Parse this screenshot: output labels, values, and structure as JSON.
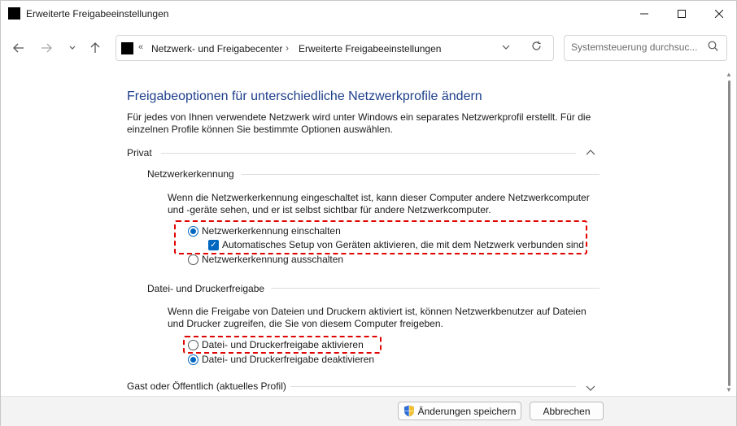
{
  "window": {
    "title": "Erweiterte Freigabeeinstellungen",
    "icons": [
      "app-icon",
      "minimize-icon",
      "maximize-icon",
      "close-icon"
    ]
  },
  "nav": {
    "icons": [
      "back-arrow-icon",
      "forward-arrow-icon",
      "recent-locations-chevron-icon",
      "up-arrow-icon"
    ]
  },
  "address": {
    "crumbs": [
      "Netzwerk- und Freigabecenter",
      "Erweiterte Freigabeeinstellungen"
    ],
    "icons": [
      "control-panel-icon",
      "overflow-chevron-icon",
      "dropdown-chevron-icon",
      "refresh-icon"
    ]
  },
  "search": {
    "placeholder": "Systemsteuerung durchsuc...",
    "icon": "search-icon"
  },
  "main": {
    "heading": "Freigabeoptionen für unterschiedliche Netzwerkprofile ändern",
    "intro": "Für jedes von Ihnen verwendete Netzwerk wird unter Windows ein separates Netzwerkprofil erstellt. Für die einzelnen Profile können Sie bestimmte Optionen auswählen.",
    "private": {
      "title": "Privat",
      "expanded": true,
      "discovery": {
        "title": "Netzwerkerkennung",
        "description": "Wenn die Netzwerkerkennung eingeschaltet ist, kann dieser Computer andere Netzwerkcomputer und -geräte sehen, und er ist selbst sichtbar für andere Netzwerkcomputer.",
        "option_on": "Netzwerkerkennung einschalten",
        "option_on_checked": true,
        "auto_setup": "Automatisches Setup von Geräten aktivieren, die mit dem Netzwerk verbunden sind",
        "auto_setup_checked": true,
        "option_off": "Netzwerkerkennung ausschalten",
        "option_off_checked": false
      },
      "sharing": {
        "title": "Datei- und Druckerfreigabe",
        "description": "Wenn die Freigabe von Dateien und Druckern aktiviert ist, können Netzwerkbenutzer auf Dateien und Drucker zugreifen, die Sie von diesem Computer freigeben.",
        "option_on": "Datei- und Druckerfreigabe aktivieren",
        "option_on_checked": false,
        "option_off": "Datei- und Druckerfreigabe deaktivieren",
        "option_off_checked": true
      }
    },
    "guest": {
      "title": "Gast oder Öffentlich (aktuelles Profil)",
      "expanded": false
    }
  },
  "footer": {
    "save_label": "Änderungen speichern",
    "cancel_label": "Abbrechen"
  },
  "colors": {
    "heading": "#1e3f8a",
    "accent": "#0067c0",
    "highlight": "#e00000"
  }
}
